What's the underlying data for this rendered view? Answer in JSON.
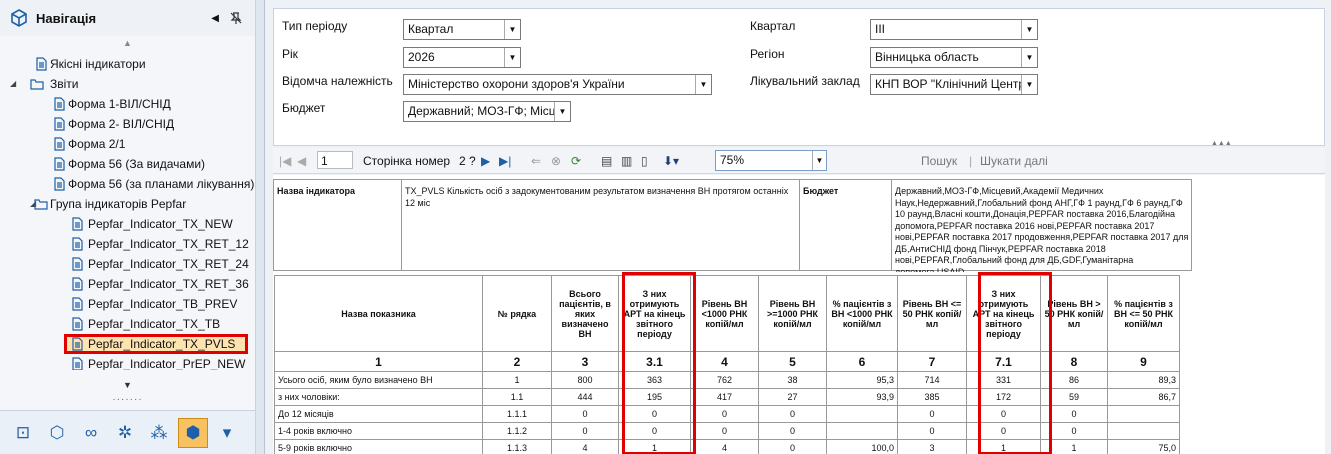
{
  "nav": {
    "title": "Навігація",
    "tree": [
      {
        "label": "Якісні індикатори",
        "level": 1,
        "kind": "doc"
      },
      {
        "label": "Звіти",
        "level": 0,
        "kind": "folder",
        "expanded": true
      },
      {
        "label": "Форма 1-ВІЛ/СНІД",
        "level": 2,
        "kind": "doc"
      },
      {
        "label": "Форма 2- ВІЛ/СНІД",
        "level": 2,
        "kind": "doc"
      },
      {
        "label": "Форма 2/1",
        "level": 2,
        "kind": "doc"
      },
      {
        "label": "Форма 56 (За видачами)",
        "level": 2,
        "kind": "doc"
      },
      {
        "label": "Форма 56 (за планами лікування)",
        "level": 2,
        "kind": "doc"
      },
      {
        "label": "Група індикаторів Pepfar",
        "level": 1,
        "kind": "folder",
        "expanded": true
      },
      {
        "label": "Pepfar_Indicator_TX_NEW",
        "level": 3,
        "kind": "doc"
      },
      {
        "label": "Pepfar_Indicator_TX_RET_12",
        "level": 3,
        "kind": "doc"
      },
      {
        "label": "Pepfar_Indicator_TX_RET_24",
        "level": 3,
        "kind": "doc"
      },
      {
        "label": "Pepfar_Indicator_TX_RET_36",
        "level": 3,
        "kind": "doc"
      },
      {
        "label": "Pepfar_Indicator_TB_PREV",
        "level": 3,
        "kind": "doc"
      },
      {
        "label": "Pepfar_Indicator_TX_TB",
        "level": 3,
        "kind": "doc"
      },
      {
        "label": "Pepfar_Indicator_TX_PVLS",
        "level": 3,
        "kind": "doc",
        "selected": true
      },
      {
        "label": "Pepfar_Indicator_PrEP_NEW",
        "level": 3,
        "kind": "doc"
      }
    ],
    "bottom_icons": [
      "camera-folder-icon",
      "cubes-icon",
      "binoculars-icon",
      "gear-icon",
      "molecule-icon",
      "cube-icon",
      "dropdown-arrow-icon"
    ]
  },
  "params": {
    "period_type_label": "Тип періоду",
    "period_type_value": "Квартал",
    "year_label": "Рік",
    "year_value": "2026",
    "department_label": "Відомча належність",
    "department_value": "Міністерство охорони здоров'я України",
    "budget_label": "Бюджет",
    "budget_value": "Державний; МОЗ-ГФ; Місц",
    "quarter_label": "Квартал",
    "quarter_value": "III",
    "region_label": "Регіон",
    "region_value": "Вінницька область",
    "facility_label": "Лікувальний заклад",
    "facility_value": "КНП ВОР \"Клінічний Центр"
  },
  "toolbar": {
    "page_value": "1",
    "page_label": "Сторінка номер",
    "page_total": "2 ?",
    "zoom": "75%",
    "search_label": "Пошук",
    "find_next_label": "Шукати далі"
  },
  "report": {
    "indicator_name_label": "Назва індикатора",
    "indicator_name_value": "TX_PVLS Кількість осіб з задокументованим результатом визначення ВН протягом останніх 12 міс",
    "budget_label": "Бюджет",
    "budget_value": "Державний,МОЗ-ГФ,Місцевий,Академії Медичних Наук,Недержавний,Глобальний фонд АНГ,ГФ 1 раунд,ГФ 6 раунд,ГФ 10 раунд,Власні кошти,Донація,PEPFAR поставка 2016,Благодійна допомога,PEPFAR поставка 2016 нові,PEPFAR поставка 2017 нові,PEPFAR поставка 2017 продовження,PEPFAR поставка 2017 для ДБ,АнтиСНІД фонд Пінчук,PEPFAR поставка 2018 нові,PEPFAR,Глобальний фонд для ДБ,GDF,Гуманітарна допомога,USAID",
    "columns": [
      "Назва показника",
      "№ рядка",
      "Всього пацієнтів, в яких визначено ВН",
      "З них отримують АРТ на кінець звітного періоду",
      "Рівень ВН <1000 РНК копій/мл",
      "Рівень ВН >=1000 РНК копій/мл",
      "% пацієнтів з ВН <1000 РНК копій/мл",
      "Рівень ВН <= 50 РНК копій/мл",
      "З них отримують АРТ на кінець звітного періоду",
      "Рівень ВН > 50 РНК копій/мл",
      "% пацієнтів з ВН <= 50 РНК копій/мл"
    ],
    "column_numbers": [
      "1",
      "2",
      "3",
      "3.1",
      "4",
      "5",
      "6",
      "7",
      "7.1",
      "8",
      "9"
    ],
    "rows": [
      [
        "Усього осіб, яким було визначено ВН",
        "1",
        "800",
        "363",
        "762",
        "38",
        "95,3",
        "714",
        "331",
        "86",
        "89,3"
      ],
      [
        "з них чоловіки:",
        "1.1",
        "444",
        "195",
        "417",
        "27",
        "93,9",
        "385",
        "172",
        "59",
        "86,7"
      ],
      [
        "До 12 місяців",
        "1.1.1",
        "0",
        "0",
        "0",
        "0",
        "",
        "0",
        "0",
        "0",
        ""
      ],
      [
        "1-4 років включно",
        "1.1.2",
        "0",
        "0",
        "0",
        "0",
        "",
        "0",
        "0",
        "0",
        ""
      ],
      [
        "5-9 років включно",
        "1.1.3",
        "4",
        "1",
        "4",
        "0",
        "100,0",
        "3",
        "1",
        "1",
        "75,0"
      ]
    ]
  }
}
